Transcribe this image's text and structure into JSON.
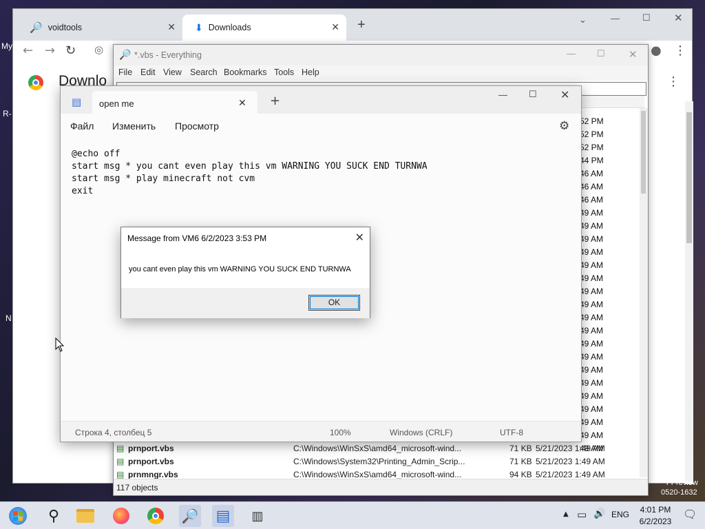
{
  "desktop": {
    "labels": [
      "My",
      "R-",
      "N"
    ]
  },
  "chrome": {
    "tabs": [
      {
        "title": "voidtools"
      },
      {
        "title": "Downloads"
      }
    ],
    "page_heading": "Downlo",
    "colors": {
      "tab_bar": "#dee1e6",
      "active_tab": "#ffffff"
    }
  },
  "everything": {
    "title": "*.vbs - Everything",
    "menu": [
      "File",
      "Edit",
      "View",
      "Search",
      "Bookmarks",
      "Tools",
      "Help"
    ],
    "times_visible": [
      "52 PM",
      "52 PM",
      "52 PM",
      "44 PM",
      "46 AM",
      "46 AM",
      "46 AM",
      "49 AM",
      "49 AM",
      "49 AM",
      "49 AM",
      "49 AM",
      "49 AM",
      "49 AM",
      "49 AM",
      "49 AM",
      "49 AM",
      "49 AM",
      "49 AM",
      "49 AM",
      "49 AM",
      "49 AM",
      "49 AM",
      "49 AM",
      "49 AM",
      "49 AM"
    ],
    "rows": [
      {
        "name": "prnport.vbs",
        "path": "C:\\Windows\\WinSxS\\amd64_microsoft-wind...",
        "size": "71 KB",
        "date": "5/21/2023 1:49 AM"
      },
      {
        "name": "prnport.vbs",
        "path": "C:\\Windows\\System32\\Printing_Admin_Scrip...",
        "size": "71 KB",
        "date": "5/21/2023 1:49 AM"
      },
      {
        "name": "prnmngr.vbs",
        "path": "C:\\Windows\\WinSxS\\amd64_microsoft-wind...",
        "size": "94 KB",
        "date": "5/21/2023 1:49 AM"
      }
    ],
    "status": "117 objects"
  },
  "notepad": {
    "tab_title": "open me",
    "menu": [
      "Файл",
      "Изменить",
      "Просмотр"
    ],
    "content": "@echo off\nstart msg * you cant even play this vm WARNING YOU SUCK END TURNWA\nstart msg * play minecraft not cvm\nexit",
    "status": {
      "position": "Строка 4, столбец 5",
      "zoom": "100%",
      "line_ending": "Windows (CRLF)",
      "encoding": "UTF-8"
    }
  },
  "dialog": {
    "title": "Message from VM6 6/2/2023 3:53 PM",
    "message": "you cant even play this vm WARNING YOU SUCK END TURNWA",
    "ok_label": "OK"
  },
  "watermark": {
    "line1": "r Preview",
    "line2": "0520-1632"
  },
  "taskbar": {
    "icons": [
      "start-icon",
      "search-icon",
      "file-explorer-icon",
      "firefox-icon",
      "chrome-icon",
      "everything-icon",
      "notepad-icon",
      "app-window-icon"
    ],
    "language": "ENG",
    "time": "4:01 PM",
    "date": "6/2/2023"
  }
}
